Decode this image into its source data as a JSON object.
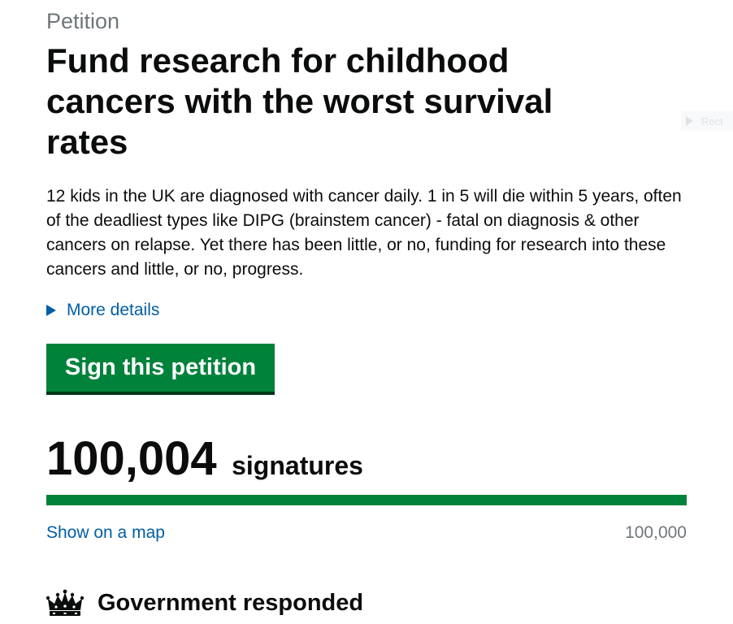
{
  "petition": {
    "kicker": "Petition",
    "title": "Fund research for childhood cancers with the worst survival rates",
    "summary": "12 kids in the UK are diagnosed with cancer daily. 1 in 5 will die within 5 years, often of the deadliest types like DIPG (brainstem cancer) - fatal on diagnosis & other cancers on relapse. Yet there has been little, or no, funding for research into these cancers and little, or no, progress.",
    "more_details": "More details",
    "sign_button": "Sign this petition"
  },
  "signatures": {
    "count": "100,004",
    "label": "signatures",
    "threshold": "100,000",
    "progress_fraction": 1.0,
    "map_link": "Show on a map"
  },
  "government": {
    "status": "Government responded",
    "icon": "crown-icon"
  },
  "side_widget": {
    "label": "Rect"
  },
  "colors": {
    "accent_green": "#00823b",
    "link_blue": "#005ea5",
    "muted_grey": "#6f777b",
    "text": "#0b0c0c"
  }
}
